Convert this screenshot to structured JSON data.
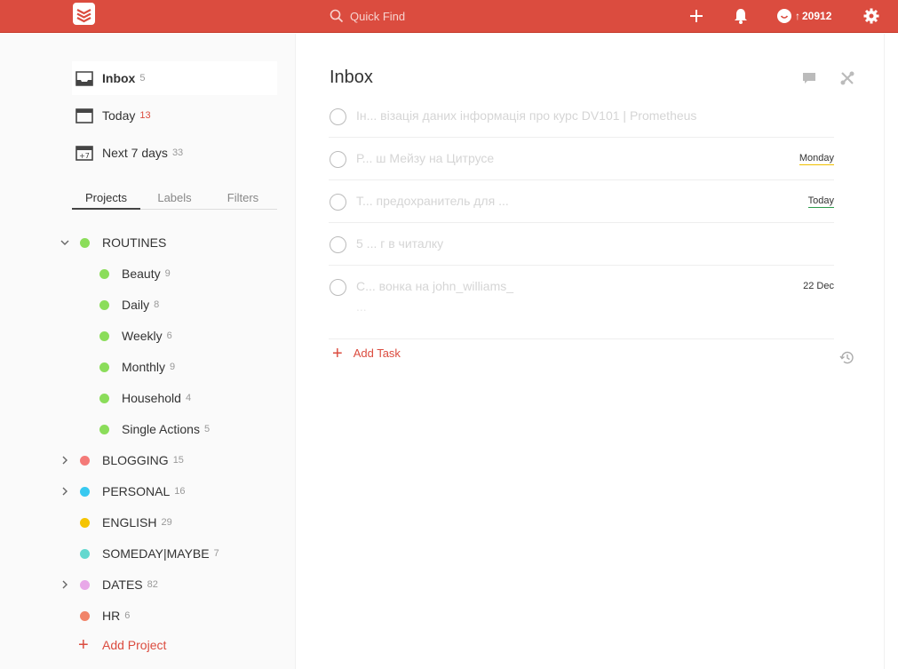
{
  "colors": {
    "brand": "#db4c3f",
    "routines": "#8bdd5a",
    "blogging": "#f47a78",
    "personal": "#38c9f0",
    "english": "#f5c400",
    "someday": "#63d8cf",
    "dates": "#e8a8e8",
    "hr": "#f18469"
  },
  "header": {
    "logo_icon": "todoist-logo-icon",
    "search_placeholder": "Quick Find",
    "karma_arrow": "↑",
    "karma_points": "20912"
  },
  "sidebar": {
    "nav": [
      {
        "label": "Inbox",
        "count": "5",
        "icon": "inbox-icon"
      },
      {
        "label": "Today",
        "count": "13",
        "icon": "calendar-icon"
      },
      {
        "label": "Next 7 days",
        "count": "33",
        "icon": "calendar-week-icon",
        "icon_text": "+7"
      }
    ],
    "tabs": [
      "Projects",
      "Labels",
      "Filters"
    ],
    "projects": [
      {
        "name": "ROUTINES",
        "count": ""
      },
      {
        "name": "Beauty",
        "count": "9"
      },
      {
        "name": "Daily",
        "count": "8"
      },
      {
        "name": "Weekly",
        "count": "6"
      },
      {
        "name": "Monthly",
        "count": "9"
      },
      {
        "name": "Household",
        "count": "4"
      },
      {
        "name": "Single Actions",
        "count": "5"
      },
      {
        "name": "BLOGGING",
        "count": "15"
      },
      {
        "name": "PERSONAL",
        "count": "16"
      },
      {
        "name": "ENGLISH",
        "count": "29"
      },
      {
        "name": "SOMEDAY|MAYBE",
        "count": "7"
      },
      {
        "name": "DATES",
        "count": "82"
      },
      {
        "name": "HR",
        "count": "6"
      }
    ],
    "add_project": "Add Project"
  },
  "main": {
    "title": "Inbox",
    "tasks": [
      {
        "text": "Ін... візація даних інформація про курс DV101 | Prometheus",
        "date": ""
      },
      {
        "text": "Р... ш Мейзу на Цитрусе",
        "date": "Monday"
      },
      {
        "text": "Т... предохранитель для ...",
        "date": "Today"
      },
      {
        "text": "5 ... г в читалку",
        "date": ""
      },
      {
        "text": "С... вонка на john_williams_",
        "text2": "...",
        "date": "22 Dec"
      }
    ],
    "add_task": "Add Task"
  }
}
